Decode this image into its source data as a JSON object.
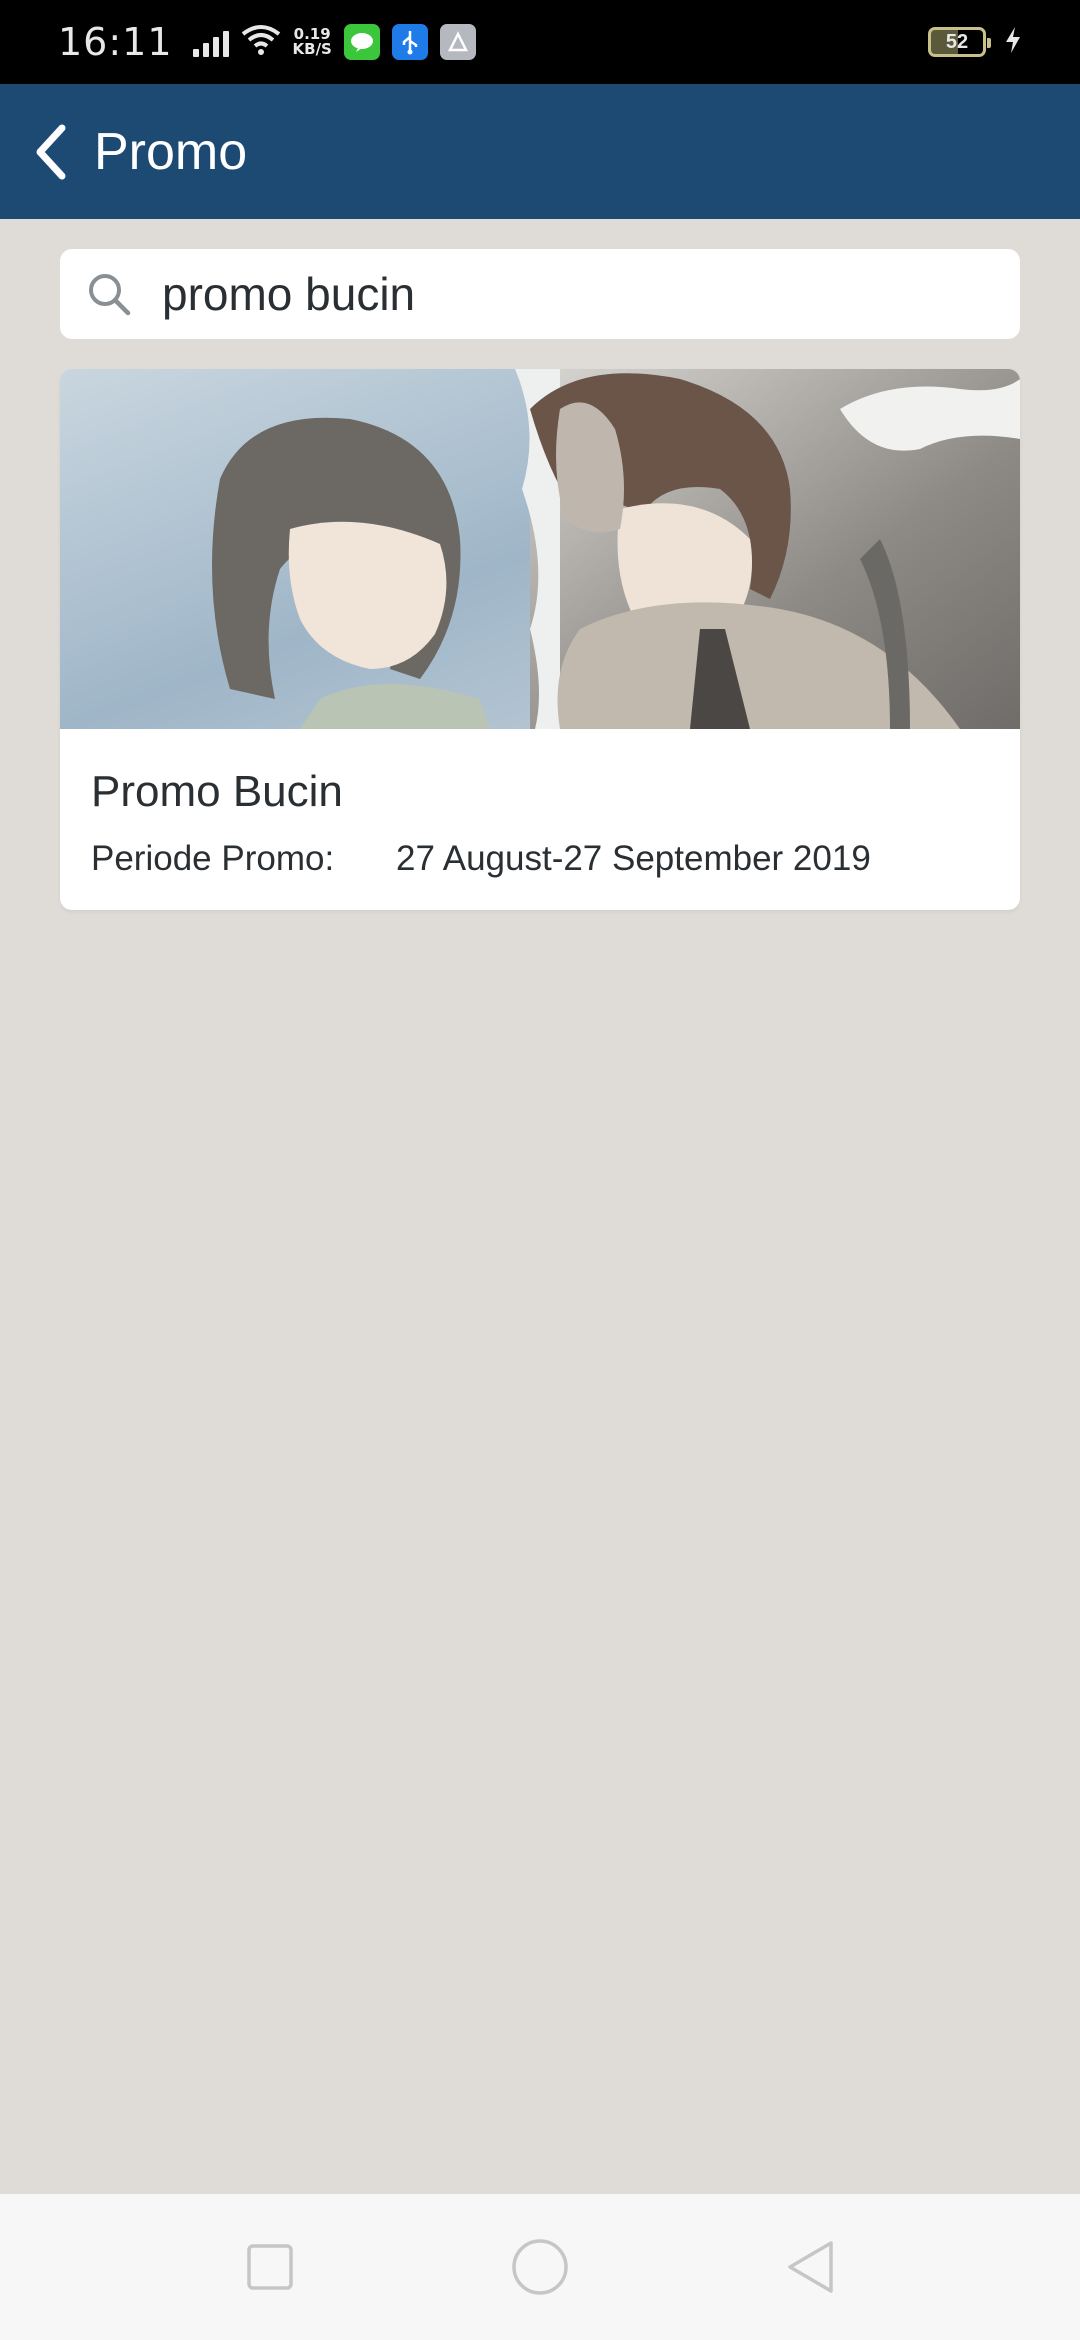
{
  "status_bar": {
    "time": "16:11",
    "speed_value": "0.19",
    "speed_unit": "KB/S",
    "battery": "52",
    "icons": [
      "signal-icon",
      "wifi-icon",
      "line-app-icon",
      "usb-icon",
      "app-icon",
      "charging-icon"
    ]
  },
  "app_bar": {
    "title": "Promo",
    "back_icon": "chevron-left-icon"
  },
  "search": {
    "value": "promo bucin",
    "icon": "search-icon"
  },
  "promo_card": {
    "title": "Promo Bucin",
    "period_label": "Periode Promo:",
    "period_value": "27 August-27 September 2019"
  },
  "nav_bar": {
    "buttons": [
      "recent-apps",
      "home",
      "back"
    ]
  },
  "colors": {
    "app_bar": "#1d4a73",
    "background": "#dfdcd8",
    "card": "#ffffff",
    "text": "#2a2f33"
  }
}
